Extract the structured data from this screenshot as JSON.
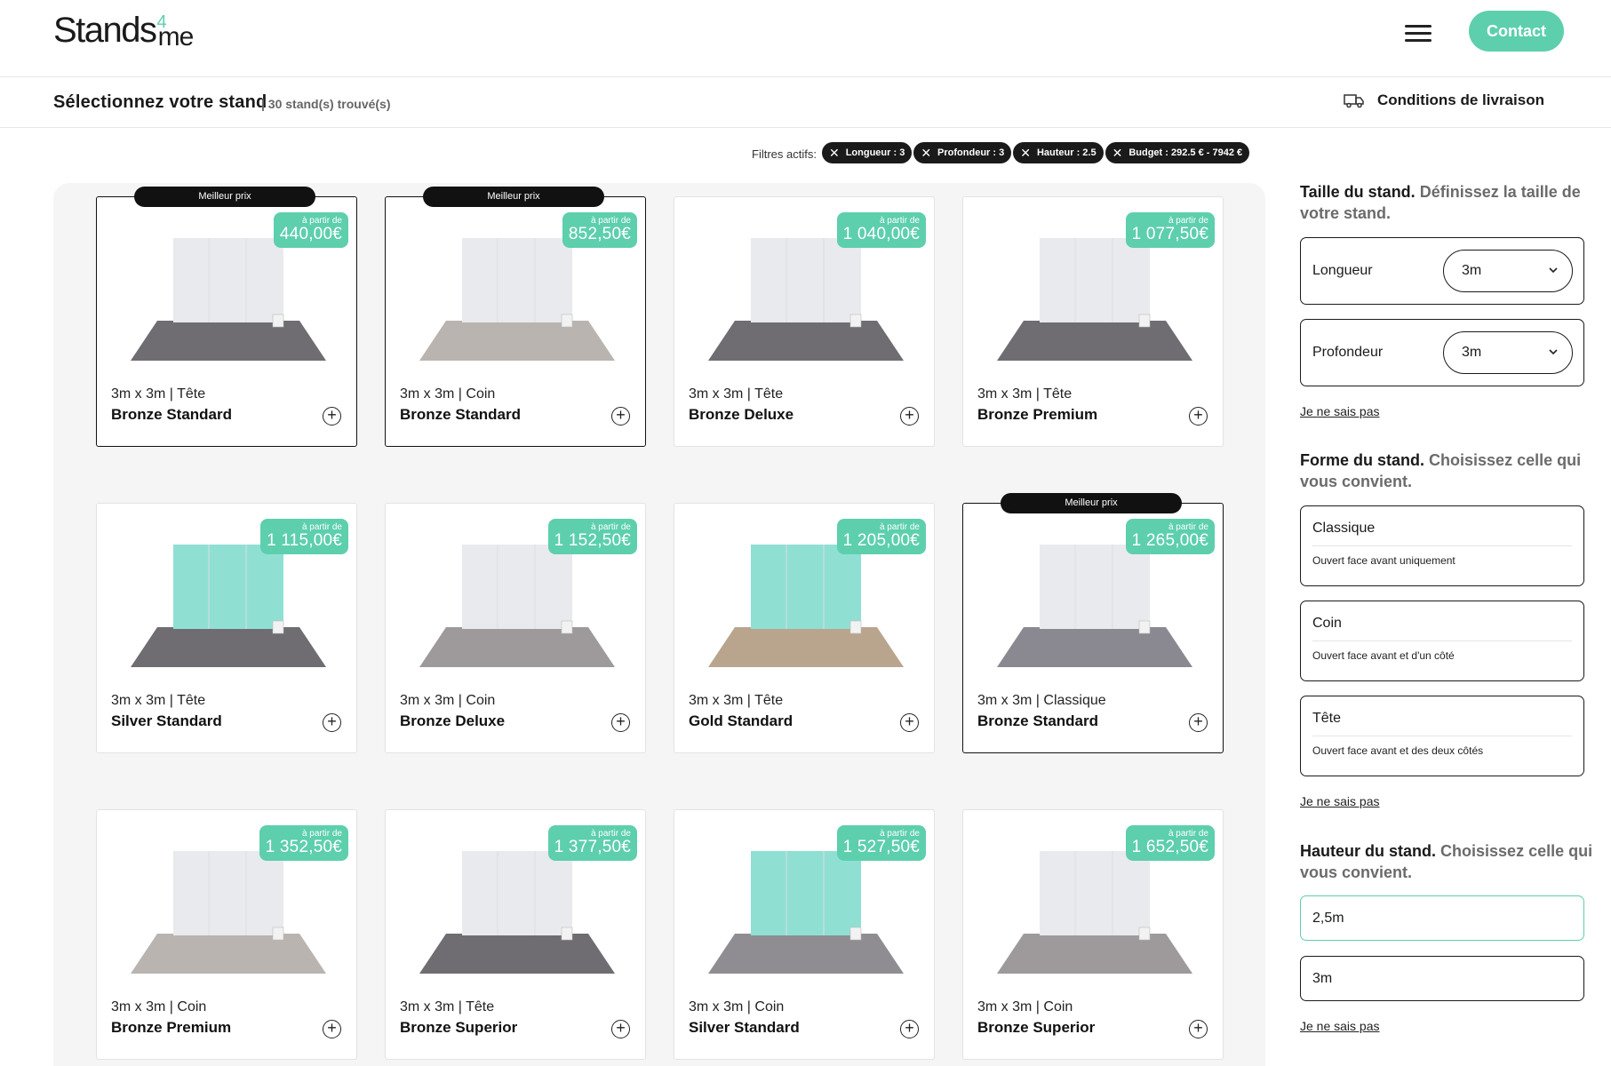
{
  "header": {
    "logo": {
      "main": "Stands",
      "sup": "4",
      "sub": "me"
    },
    "contact_label": "Contact"
  },
  "subheader": {
    "title": "Sélectionnez votre stand",
    "count": "| 30 stand(s) trouvé(s)",
    "delivery_label": "Conditions de livraison"
  },
  "filters": {
    "label": "Filtres actifs:",
    "chips": [
      "Longueur : 3",
      "Profondeur : 3",
      "Hauteur : 2.5",
      "Budget : 292.5 € - 7942 €"
    ]
  },
  "price_prefix": "à partir de",
  "best_label": "Meilleur prix",
  "cards": [
    {
      "dims": "3m x 3m | Tête",
      "name": "Bronze Standard",
      "price": "440,00€",
      "best": true
    },
    {
      "dims": "3m x 3m | Coin",
      "name": "Bronze Standard",
      "price": "852,50€",
      "best": true
    },
    {
      "dims": "3m x 3m | Tête",
      "name": "Bronze Deluxe",
      "price": "1 040,00€",
      "best": false
    },
    {
      "dims": "3m x 3m | Tête",
      "name": "Bronze Premium",
      "price": "1 077,50€",
      "best": false
    },
    {
      "dims": "3m x 3m | Tête",
      "name": "Silver Standard",
      "price": "1 115,00€",
      "best": false
    },
    {
      "dims": "3m x 3m | Coin",
      "name": "Bronze Deluxe",
      "price": "1 152,50€",
      "best": false
    },
    {
      "dims": "3m x 3m | Tête",
      "name": "Gold Standard",
      "price": "1 205,00€",
      "best": false
    },
    {
      "dims": "3m x 3m | Classique",
      "name": "Bronze Standard",
      "price": "1 265,00€",
      "best": true
    },
    {
      "dims": "3m x 3m | Coin",
      "name": "Bronze Premium",
      "price": "1 352,50€",
      "best": false
    },
    {
      "dims": "3m x 3m | Tête",
      "name": "Bronze Superior",
      "price": "1 377,50€",
      "best": false
    },
    {
      "dims": "3m x 3m | Coin",
      "name": "Silver Standard",
      "price": "1 527,50€",
      "best": false
    },
    {
      "dims": "3m x 3m | Coin",
      "name": "Bronze Superior",
      "price": "1 652,50€",
      "best": false
    }
  ],
  "sidebar": {
    "size": {
      "title": "Taille du stand.",
      "subtitle": "Définissez la taille de votre stand.",
      "length_label": "Longueur",
      "length_value": "3m",
      "depth_label": "Profondeur",
      "depth_value": "3m",
      "unknown": "Je ne sais pas"
    },
    "shape": {
      "title": "Forme du stand.",
      "subtitle": "Choisissez celle qui vous convient.",
      "options": [
        {
          "title": "Classique",
          "desc": "Ouvert face avant uniquement"
        },
        {
          "title": "Coin",
          "desc": "Ouvert face avant et d'un côté"
        },
        {
          "title": "Tête",
          "desc": "Ouvert face avant et des deux côtés"
        }
      ],
      "unknown": "Je ne sais pas"
    },
    "height": {
      "title": "Hauteur du stand.",
      "subtitle": "Choisissez celle qui vous convient.",
      "options": [
        "2,5m",
        "3m"
      ],
      "unknown": "Je ne sais pas"
    }
  },
  "colors": {
    "accent": "#5dcfad",
    "dark": "#111111"
  }
}
